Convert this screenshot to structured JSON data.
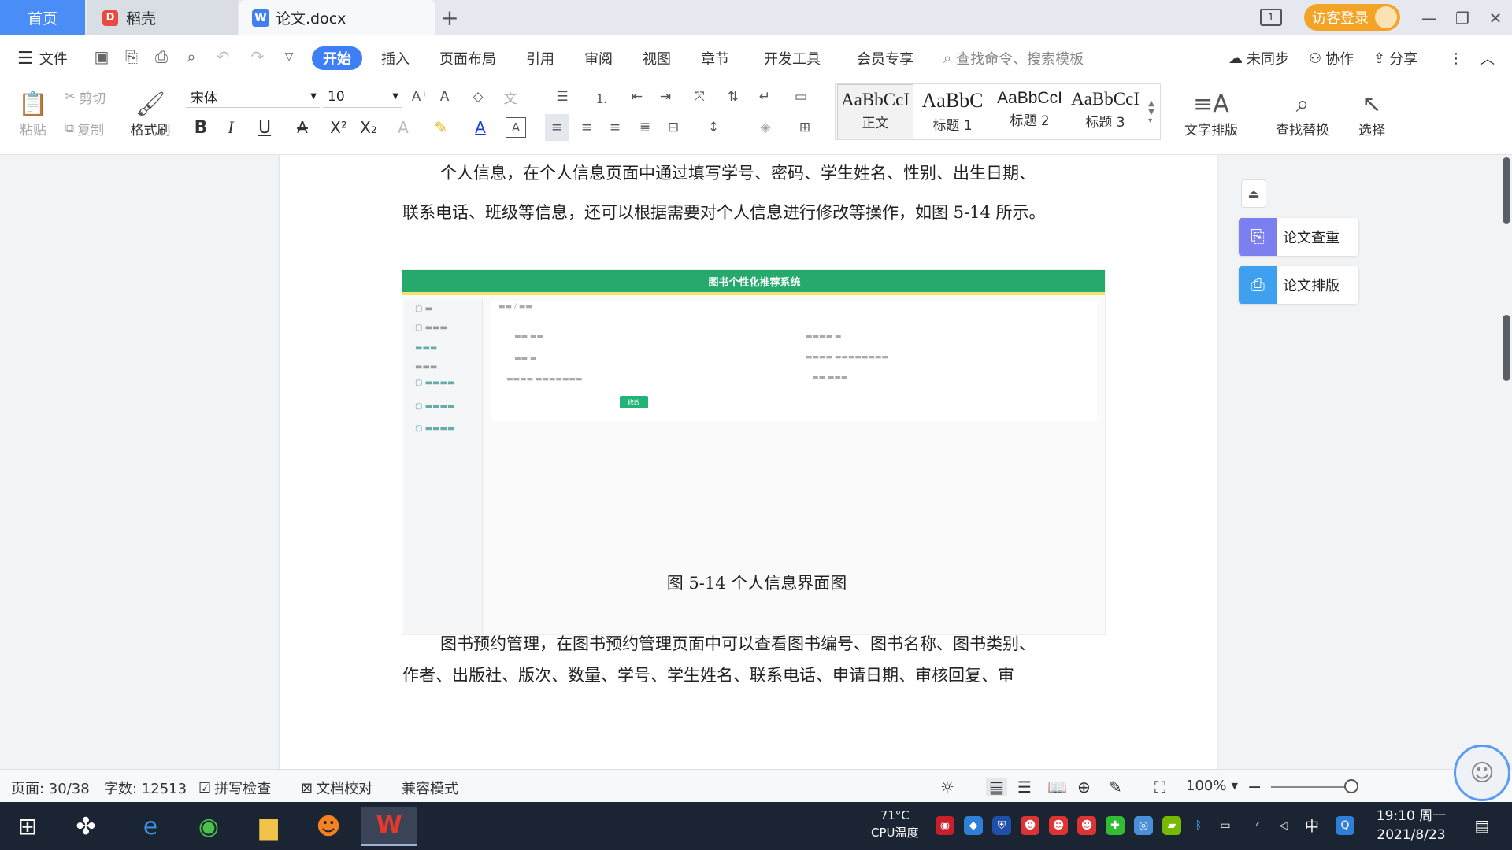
{
  "tabs": {
    "home": "首页",
    "daoke": "稻壳",
    "doc": "论文.docx"
  },
  "title_right": {
    "login": "访客登录",
    "layout_badge": "1"
  },
  "menu": {
    "file": "文件",
    "items": [
      "开始",
      "插入",
      "页面布局",
      "引用",
      "审阅",
      "视图",
      "章节",
      "开发工具",
      "会员专享"
    ],
    "search_placeholder": "查找命令、搜索模板",
    "sync": "未同步",
    "collab": "协作",
    "share": "分享"
  },
  "ribbon": {
    "paste": "粘贴",
    "cut": "剪切",
    "copy": "复制",
    "format_painter": "格式刷",
    "font_name": "宋体",
    "font_size": "10",
    "styles": [
      {
        "preview": "AaBbCcI",
        "name": "正文"
      },
      {
        "preview": "AaBbC",
        "name": "标题 1"
      },
      {
        "preview": "AaBbCcI",
        "name": "标题 2"
      },
      {
        "preview": "AaBbCcI",
        "name": "标题 3"
      }
    ],
    "text_layout": "文字排版",
    "find_replace": "查找替换",
    "select": "选择"
  },
  "document": {
    "para1_line1": "个人信息，在个人信息页面中通过填写学号、密码、学生姓名、性别、出生日期、",
    "para1_line2": "联系电话、班级等信息，还可以根据需要对个人信息进行修改等操作，如图 5-14 所示。",
    "figure": {
      "header_title": "图书个性化推荐系统",
      "save_button": "修改"
    },
    "caption": "图 5-14 个人信息界面图",
    "para2_line1": "图书预约管理，在图书预约管理页面中可以查看图书编号、图书名称、图书类别、",
    "para2_line2": "作者、出版社、版次、数量、学号、学生姓名、联系电话、申请日期、审核回复、审"
  },
  "side_panel": {
    "check": "论文查重",
    "format": "论文排版"
  },
  "status": {
    "page": "页面: 30/38",
    "words": "字数: 12513",
    "spell": "拼写检查",
    "proof": "文档校对",
    "compat": "兼容模式",
    "zoom": "100%"
  },
  "taskbar": {
    "cpu_temp": "71°C",
    "cpu_label": "CPU温度",
    "ime": "中",
    "time": "19:10 周一",
    "date": "2021/8/23"
  },
  "colors": {
    "accent": "#3e7ef7",
    "home_tab": "#4b8df7",
    "login": "#f3a325",
    "figure_green": "#25a96c"
  }
}
